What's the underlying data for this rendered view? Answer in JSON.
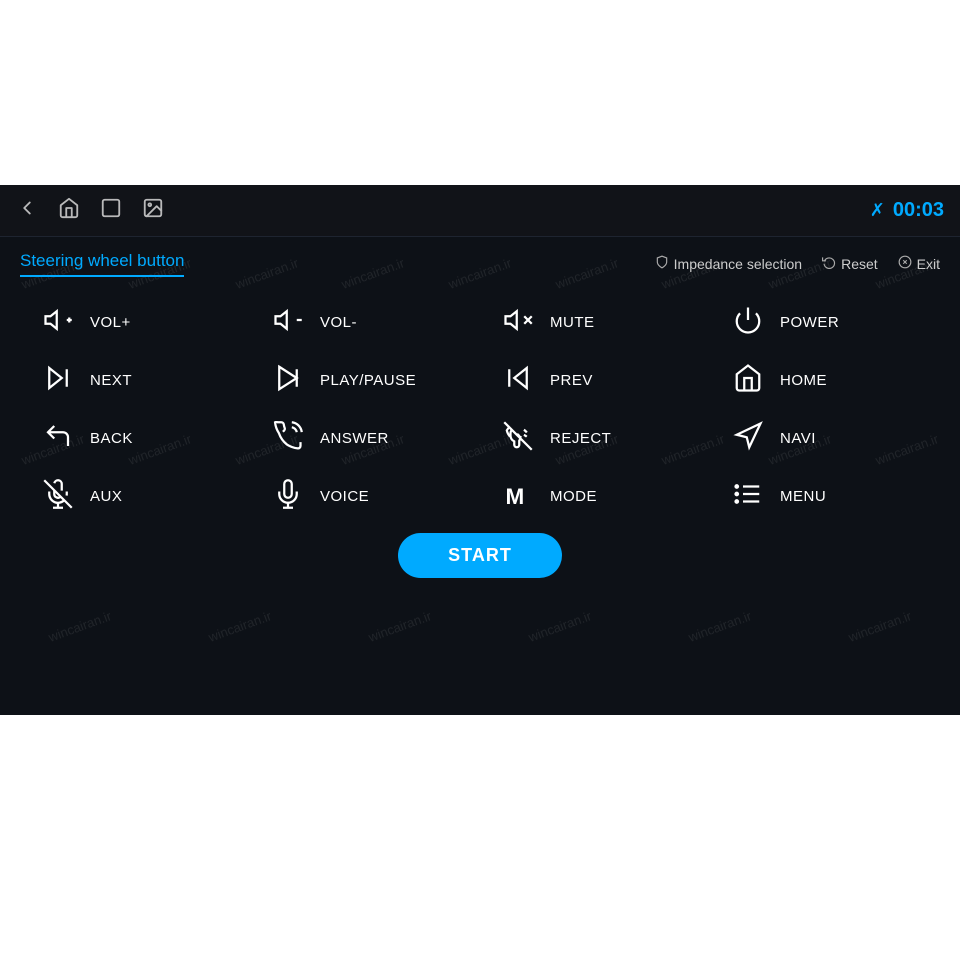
{
  "top_bar": {
    "time": "00:03",
    "bluetooth_icon": "bluetooth",
    "icons": [
      "back-icon",
      "home-icon",
      "recent-icon",
      "gallery-icon"
    ]
  },
  "title": "Steering wheel button",
  "actions": [
    {
      "icon": "shield-icon",
      "label": "Impedance selection"
    },
    {
      "icon": "reset-icon",
      "label": "Reset"
    },
    {
      "icon": "exit-icon",
      "label": "Exit"
    }
  ],
  "controls": [
    {
      "id": "vol-plus",
      "icon": "vol-plus-icon",
      "label": "VOL+"
    },
    {
      "id": "vol-minus",
      "icon": "vol-minus-icon",
      "label": "VOL-"
    },
    {
      "id": "mute",
      "icon": "mute-icon",
      "label": "MUTE"
    },
    {
      "id": "power",
      "icon": "power-icon",
      "label": "POWER"
    },
    {
      "id": "next",
      "icon": "next-icon",
      "label": "NEXT"
    },
    {
      "id": "play-pause",
      "icon": "play-pause-icon",
      "label": "PLAY/PAUSE"
    },
    {
      "id": "prev",
      "icon": "prev-icon",
      "label": "PREV"
    },
    {
      "id": "home",
      "icon": "home-ctrl-icon",
      "label": "HOME"
    },
    {
      "id": "back",
      "icon": "back-ctrl-icon",
      "label": "BACK"
    },
    {
      "id": "answer",
      "icon": "answer-icon",
      "label": "ANSWER"
    },
    {
      "id": "reject",
      "icon": "reject-icon",
      "label": "REJECT"
    },
    {
      "id": "navi",
      "icon": "navi-icon",
      "label": "NAVI"
    },
    {
      "id": "aux",
      "icon": "aux-icon",
      "label": "AUX"
    },
    {
      "id": "voice",
      "icon": "voice-icon",
      "label": "VOICE"
    },
    {
      "id": "mode",
      "icon": "mode-icon",
      "label": "MODE"
    },
    {
      "id": "menu",
      "icon": "menu-icon",
      "label": "MENU"
    }
  ],
  "start_button": "START",
  "watermark_text": "wincairan.ir"
}
